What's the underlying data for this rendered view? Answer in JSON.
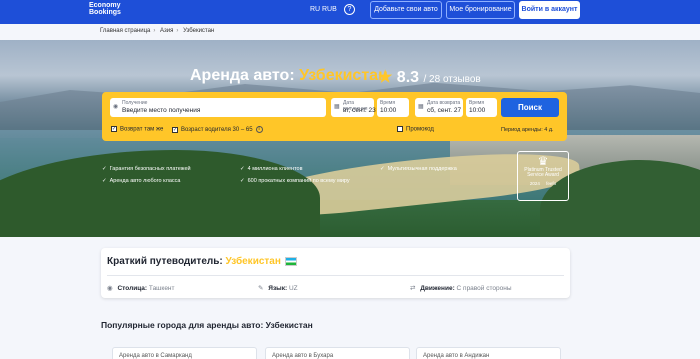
{
  "header": {
    "logo_line1": "Economy",
    "logo_line2": "Bookings",
    "lang": "RU",
    "currency": "RUB",
    "help_glyph": "?",
    "add_car_label": "Добавьте свои авто",
    "my_booking_label": "Мое бронирование",
    "login_label": "Войти в аккаунт"
  },
  "breadcrumb": [
    "Главная страница",
    "Азия",
    "Узбекистан"
  ],
  "hero": {
    "title_prefix": "Аренда авто:",
    "country": "Узбекистан",
    "rating": "8.3",
    "reviews": "/ 28 отзывов"
  },
  "search": {
    "pickup_label": "Получение",
    "pickup_placeholder": "Введите место получения",
    "pickup_date_label": "Дата получения",
    "pickup_date": "вт, сент. 23",
    "pickup_time_label": "Время",
    "pickup_time": "10:00",
    "return_date_label": "Дата возврата",
    "return_date": "сб, сент. 27",
    "return_time_label": "Время",
    "return_time": "10:00",
    "search_button": "Поиск",
    "same_return": "Возврат там же",
    "driver_age": "Возраст водителя 30 – 65",
    "promo": "Промокод",
    "rental_period": "Период аренды: 4 д."
  },
  "features": [
    "Гарантия безопасных платежей",
    "Аренда авто любого класса",
    "4 миллиона клиентов",
    "600 прокатных компаний по всему миру",
    "Мультиязычная поддержка"
  ],
  "award": {
    "line1": "Platinum Trusted",
    "line2": "Service Award",
    "year": "2024",
    "brand": "feefo"
  },
  "guide": {
    "title_prefix": "Краткий путеводитель:",
    "country": "Узбекистан",
    "capital_label": "Столица:",
    "capital_value": "Ташкент",
    "language_label": "Язык:",
    "language_value": "UZ",
    "traffic_label": "Движение:",
    "traffic_value": "С правой стороны"
  },
  "popular": {
    "title": "Популярные города для аренды авто: Узбекистан",
    "cities": [
      "Аренда авто в Самарканд",
      "Аренда авто в Бухара",
      "Аренда авто в Андижан"
    ]
  },
  "colors": {
    "brand_blue": "#1e4fd8",
    "accent_yellow": "#ffc628",
    "search_button": "#1e63e0"
  }
}
